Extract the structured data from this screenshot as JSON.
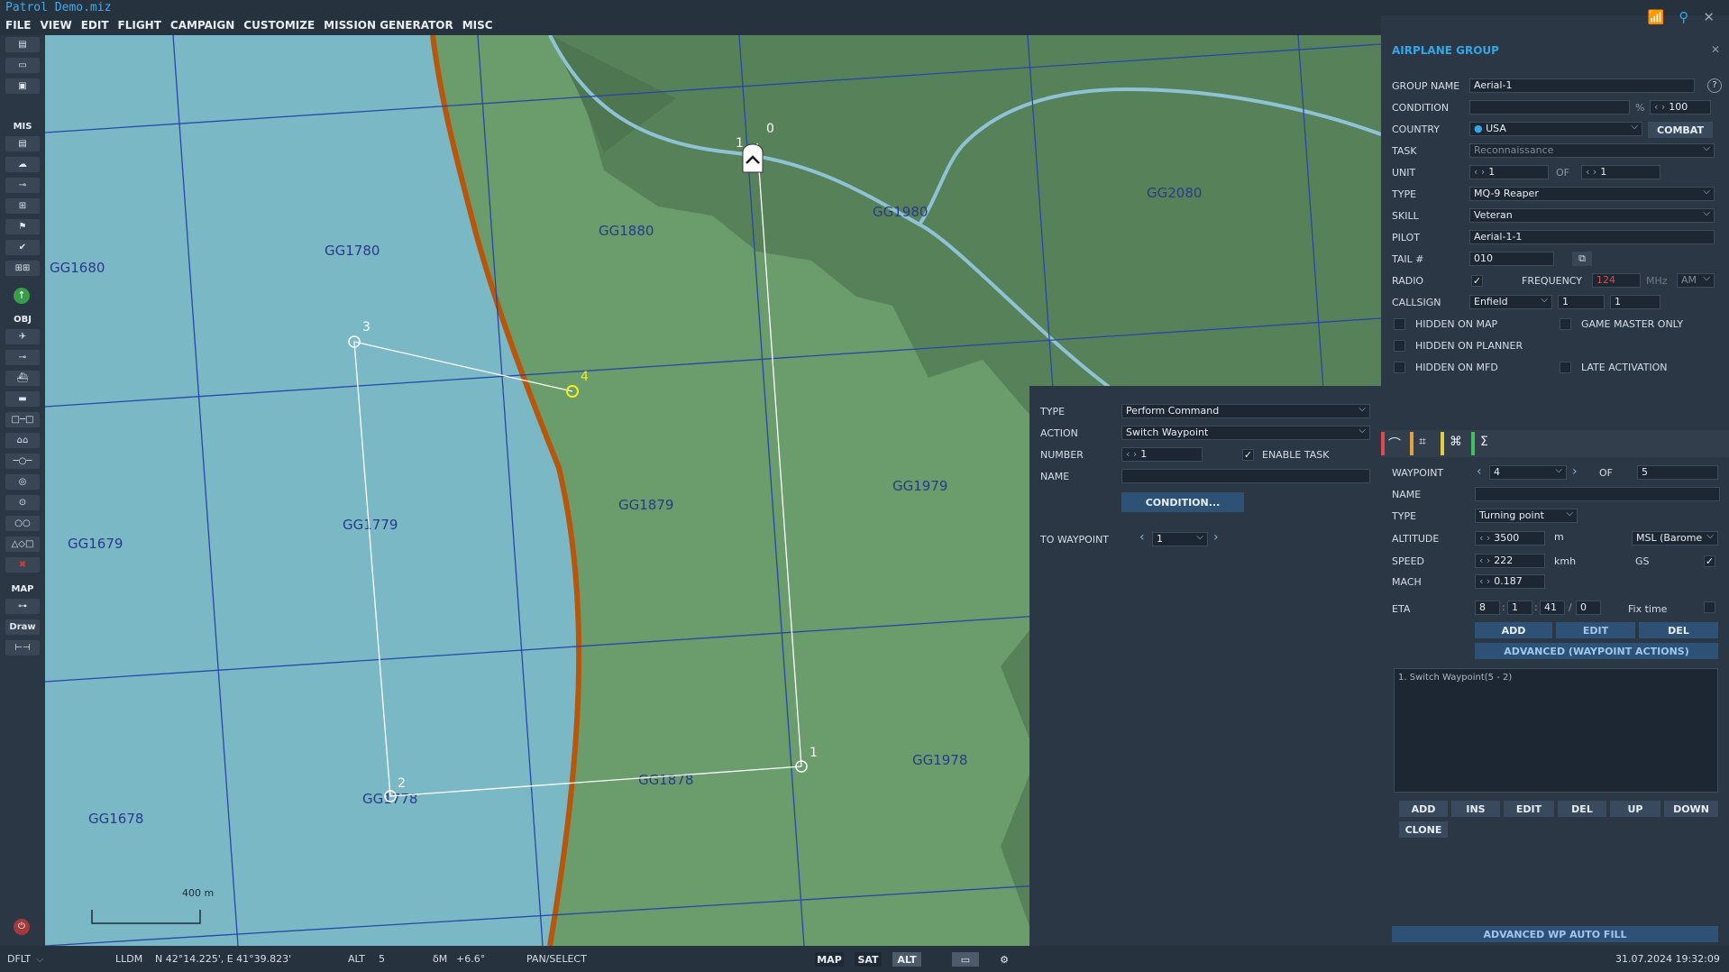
{
  "title": "Patrol Demo.miz",
  "menu": [
    "FILE",
    "VIEW",
    "EDIT",
    "FLIGHT",
    "CAMPAIGN",
    "CUSTOMIZE",
    "MISSION GENERATOR",
    "MISC"
  ],
  "toolbar": {
    "mis_label": "MIS",
    "obj_label": "OBJ",
    "map_label": "MAP",
    "draw_label": "Draw"
  },
  "map": {
    "grid_labels": [
      "GG1680",
      "GG1780",
      "GG1880",
      "GG1980",
      "GG2080",
      "GG1679",
      "GG1779",
      "GG1879",
      "GG1979",
      "GG1678",
      "GG1778",
      "GG1878",
      "GG1978"
    ],
    "waypoints_a": [
      "1",
      "2",
      "3",
      "4"
    ],
    "waypoints_b": [
      "0",
      "1"
    ],
    "scale": "400 m"
  },
  "panel": {
    "header": "AIRPLANE GROUP",
    "group_name_label": "GROUP NAME",
    "group_name": "Aerial-1",
    "condition_label": "CONDITION",
    "condition_pct": "%",
    "condition_value": "100",
    "country_label": "COUNTRY",
    "country": "USA",
    "combat": "COMBAT",
    "task_label": "TASK",
    "task": "Reconnaissance",
    "unit_label": "UNIT",
    "unit": "1",
    "unit_of": "OF",
    "unit_total": "1",
    "type_label": "TYPE",
    "type": "MQ-9 Reaper",
    "skill_label": "SKILL",
    "skill": "Veteran",
    "pilot_label": "PILOT",
    "pilot": "Aerial-1-1",
    "tail_label": "TAIL #",
    "tail": "010",
    "radio_label": "RADIO",
    "frequency_label": "FREQUENCY",
    "frequency": "124",
    "mhz": "MHz",
    "am": "AM",
    "callsign_label": "CALLSIGN",
    "callsign": "Enfield",
    "callsign_n1": "1",
    "callsign_n2": "1",
    "hidden_map": "HIDDEN ON MAP",
    "game_master": "GAME MASTER ONLY",
    "hidden_planner": "HIDDEN ON PLANNER",
    "hidden_mfd": "HIDDEN ON MFD",
    "late_activation": "LATE ACTIVATION",
    "waypoint_label": "WAYPOINT",
    "waypoint": "4",
    "waypoint_of": "OF",
    "waypoint_total": "5",
    "wp_name_label": "NAME",
    "wp_type_label": "TYPE",
    "wp_type": "Turning point",
    "altitude_label": "ALTITUDE",
    "altitude": "3500",
    "altitude_unit": "m",
    "altitude_ref": "MSL (Barome",
    "speed_label": "SPEED",
    "speed": "222",
    "speed_unit": "kmh",
    "gs": "GS",
    "mach_label": "MACH",
    "mach": "0.187",
    "eta_label": "ETA",
    "eta_d": "8",
    "eta_h": "1",
    "eta_m": "41",
    "eta_s": "0",
    "fix_time": "Fix time",
    "add": "ADD",
    "edit": "EDIT",
    "del": "DEL",
    "advanced": "ADVANCED (WAYPOINT ACTIONS)",
    "action_item": "1. Switch Waypoint(5 - 2)",
    "list_buttons": [
      "ADD",
      "INS",
      "EDIT",
      "DEL",
      "UP",
      "DOWN"
    ],
    "clone": "CLONE",
    "auto_fill": "ADVANCED WP AUTO FILL"
  },
  "task_panel": {
    "type_label": "TYPE",
    "type": "Perform Command",
    "action_label": "ACTION",
    "action": "Switch Waypoint",
    "number_label": "NUMBER",
    "number": "1",
    "enable_task": "ENABLE TASK",
    "name_label": "NAME",
    "condition_button": "CONDITION...",
    "to_waypoint_label": "TO WAYPOINT",
    "to_waypoint": "1"
  },
  "status": {
    "dflt": "DFLT",
    "coord_mode": "LLDM",
    "coords": "N 42°14.225', E 41°39.823'",
    "alt_label": "ALT",
    "alt": "5",
    "dm_label": "δM",
    "dm": "+6.6°",
    "mode": "PAN/SELECT",
    "map_btn": "MAP",
    "sat_btn": "SAT",
    "alt_btn": "ALT",
    "datetime": "31.07.2024 19:32:09"
  },
  "colors": {
    "sea": "#7ab8c6",
    "land": "#6a9c6c",
    "forest": "#557f58",
    "coast": "#b8560c",
    "road": "#8ec3d6",
    "grid": "#2a46a8",
    "accent": "#35a6e6"
  }
}
